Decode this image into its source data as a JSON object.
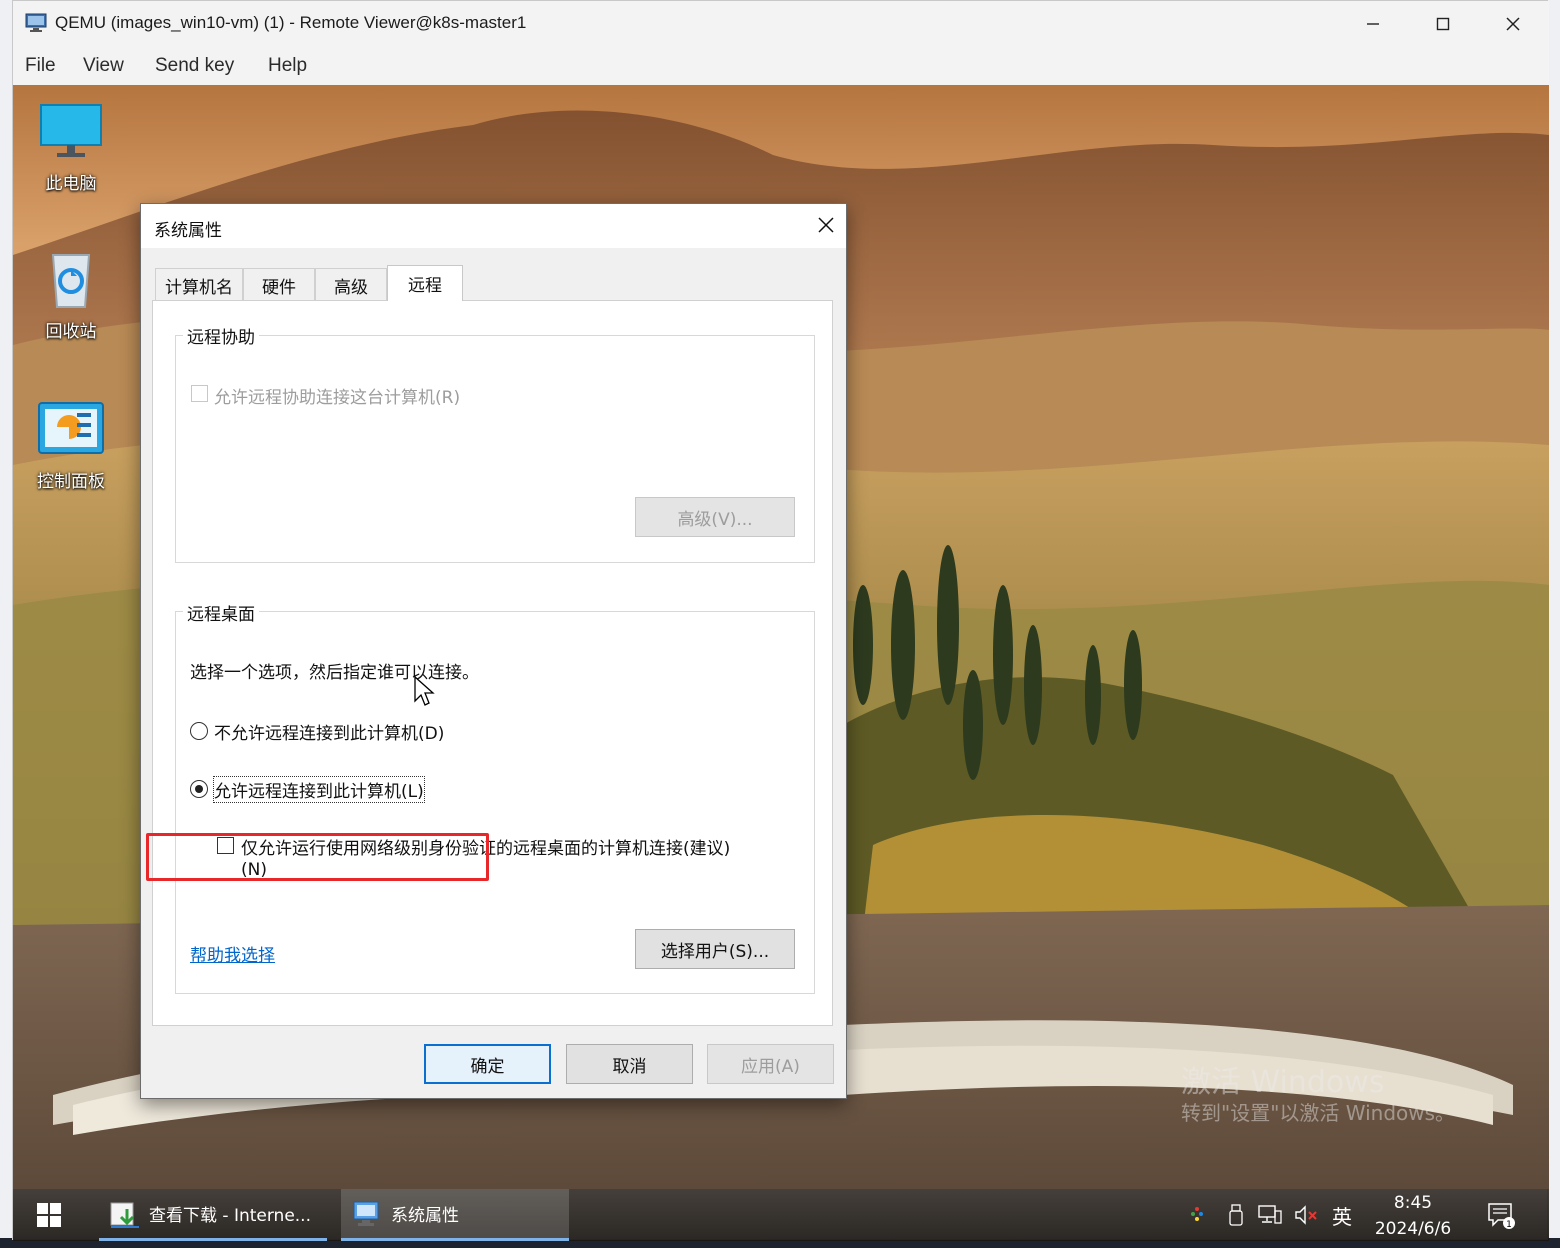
{
  "window": {
    "title": "QEMU (images_win10-vm) (1) - Remote Viewer@k8s-master1",
    "menu": [
      "File",
      "View",
      "Send key",
      "Help"
    ]
  },
  "desktop": {
    "icons": [
      {
        "label": "此电脑",
        "icon": "monitor-icon"
      },
      {
        "label": "回收站",
        "icon": "recycle-bin-icon"
      },
      {
        "label": "控制面板",
        "icon": "control-panel-icon"
      }
    ],
    "watermark": {
      "title": "激活 Windows",
      "subtitle": "转到\"设置\"以激活 Windows。"
    }
  },
  "dialog": {
    "title": "系统属性",
    "tabs": [
      "计算机名",
      "硬件",
      "高级",
      "远程"
    ],
    "active_tab": "远程",
    "remote_assistance": {
      "group_label": "远程协助",
      "checkbox_label": "允许远程协助连接这台计算机(R)",
      "checked": false,
      "enabled": false,
      "advanced_button": "高级(V)..."
    },
    "remote_desktop": {
      "group_label": "远程桌面",
      "instruction": "选择一个选项，然后指定谁可以连接。",
      "option_deny": "不允许远程连接到此计算机(D)",
      "option_allow": "允许远程连接到此计算机(L)",
      "selected": "allow",
      "nla_checkbox_line1": "仅允许运行使用网络级别身份验证的远程桌面的计算机连接(建议)",
      "nla_checkbox_line2": "(N)",
      "nla_checked": false,
      "help_link": "帮助我选择",
      "select_users_button": "选择用户(S)..."
    },
    "buttons": {
      "ok": "确定",
      "cancel": "取消",
      "apply": "应用(A)"
    }
  },
  "taskbar": {
    "apps": [
      {
        "label": "查看下载 - Interne...",
        "icon": "downloads-icon"
      },
      {
        "label": "系统属性",
        "icon": "system-properties-icon"
      }
    ],
    "ime": "英",
    "time": "8:45",
    "date": "2024/6/6",
    "notification_count": "1"
  }
}
